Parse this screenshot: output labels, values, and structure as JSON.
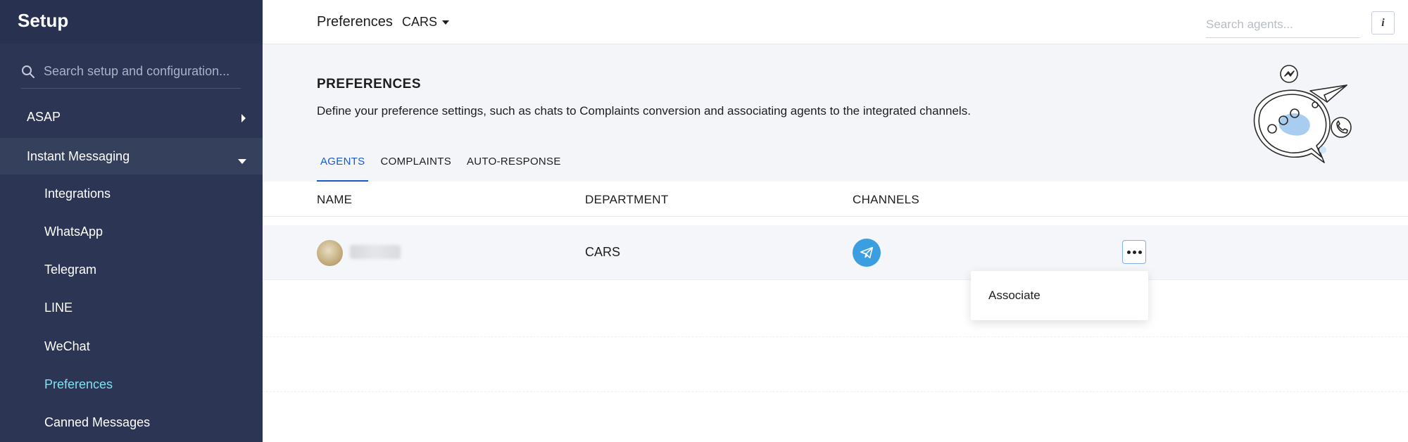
{
  "sidebar": {
    "title": "Setup",
    "search_placeholder": "Search setup and configuration...",
    "sections": [
      {
        "label": "ASAP",
        "expanded": false
      },
      {
        "label": "Instant Messaging",
        "expanded": true
      }
    ],
    "sub_items": [
      {
        "label": "Integrations",
        "active": false
      },
      {
        "label": "WhatsApp",
        "active": false
      },
      {
        "label": "Telegram",
        "active": false
      },
      {
        "label": "LINE",
        "active": false
      },
      {
        "label": "WeChat",
        "active": false
      },
      {
        "label": "Preferences",
        "active": true
      },
      {
        "label": "Canned Messages",
        "active": false
      }
    ]
  },
  "topbar": {
    "title": "Preferences",
    "department": "CARS",
    "search_placeholder": "Search agents...",
    "info_label": "i"
  },
  "page": {
    "heading": "PREFERENCES",
    "description": "Define your preference settings, such as chats to Complaints conversion and associating agents to the integrated channels.",
    "tabs": [
      {
        "label": "AGENTS",
        "active": true
      },
      {
        "label": "COMPLAINTS",
        "active": false
      },
      {
        "label": "AUTO-RESPONSE",
        "active": false
      }
    ]
  },
  "table": {
    "columns": [
      "NAME",
      "DEPARTMENT",
      "CHANNELS"
    ],
    "rows": [
      {
        "name": "",
        "department": "CARS",
        "channel_icon": "telegram-icon"
      }
    ]
  },
  "row_menu": {
    "items": [
      "Associate"
    ]
  },
  "colors": {
    "sidebar_bg": "#2c3654",
    "active_sub_item": "#7fe0f2",
    "active_tab": "#1a5ac8",
    "telegram_icon_bg": "#3a9ee0"
  }
}
